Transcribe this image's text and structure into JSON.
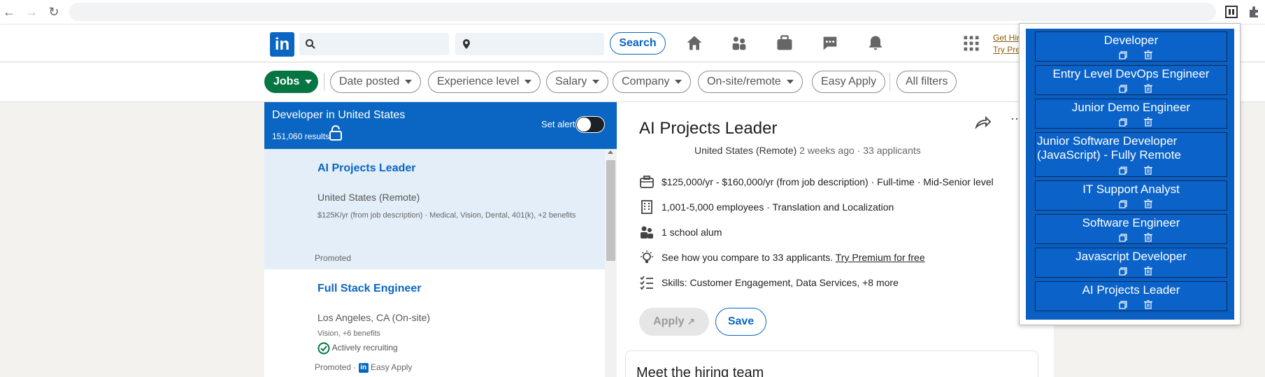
{
  "header": {
    "search_button": "Search",
    "premium_line1": "Get Hir",
    "premium_line2": "Try Prem"
  },
  "filters": {
    "jobs": "Jobs",
    "date_posted": "Date posted",
    "experience_level": "Experience level",
    "salary": "Salary",
    "company": "Company",
    "onsite_remote": "On-site/remote",
    "easy_apply": "Easy Apply",
    "all_filters": "All filters"
  },
  "results": {
    "title": "Developer in United States",
    "count": "151,060 results",
    "set_alert": "Set alert",
    "jobs": [
      {
        "title": "AI Projects Leader",
        "location": "United States (Remote)",
        "meta": "$125K/yr (from job description) · Medical, Vision, Dental, 401(k), +2 benefits",
        "promoted": "Promoted"
      },
      {
        "title": "Full Stack Engineer",
        "location": "Los Angeles, CA (On-site)",
        "meta": "Vision, +6 benefits",
        "recruiting": "Actively recruiting",
        "promoted": "Promoted ·",
        "easy_apply": "Easy Apply"
      }
    ]
  },
  "detail": {
    "title": "AI Projects Leader",
    "location": "United States (Remote)",
    "posted": "2 weeks ago · 33 applicants",
    "salary_line": "$125,000/yr - $160,000/yr (from job description) · Full-time · Mid-Senior level",
    "company_line": "1,001-5,000 employees · Translation and Localization",
    "alum_line": "1 school alum",
    "compare_text": "See how you compare to 33 applicants.",
    "compare_link": "Try Premium for free",
    "skills_line": "Skills: Customer Engagement, Data Services, +8 more",
    "apply": "Apply",
    "save": "Save",
    "hiring_team": "Meet the hiring team"
  },
  "extension": {
    "items": [
      "Developer",
      "Entry Level DevOps Engineer",
      "Junior Demo Engineer",
      "Junior Software Developer (JavaScript) - Fully Remote",
      "IT Support Analyst",
      "Software Engineer",
      "Javascript Developer",
      "AI Projects Leader"
    ]
  },
  "colors": {
    "linkedin_blue": "#0a66c2",
    "jobs_green": "#057642",
    "extension_blue": "#0a5fc2"
  }
}
